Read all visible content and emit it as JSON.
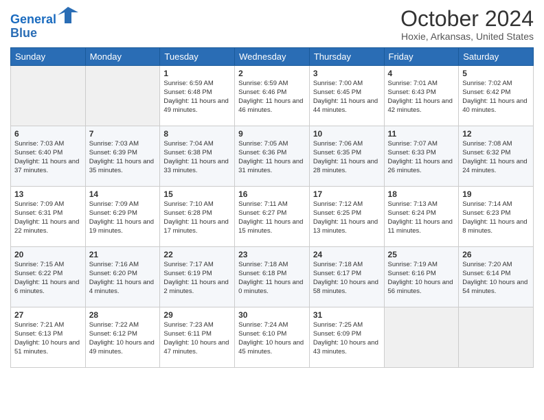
{
  "header": {
    "logo_line1": "General",
    "logo_line2": "Blue",
    "title": "October 2024",
    "subtitle": "Hoxie, Arkansas, United States"
  },
  "weekdays": [
    "Sunday",
    "Monday",
    "Tuesday",
    "Wednesday",
    "Thursday",
    "Friday",
    "Saturday"
  ],
  "weeks": [
    [
      {
        "day": "",
        "info": ""
      },
      {
        "day": "",
        "info": ""
      },
      {
        "day": "1",
        "info": "Sunrise: 6:59 AM\nSunset: 6:48 PM\nDaylight: 11 hours and 49 minutes."
      },
      {
        "day": "2",
        "info": "Sunrise: 6:59 AM\nSunset: 6:46 PM\nDaylight: 11 hours and 46 minutes."
      },
      {
        "day": "3",
        "info": "Sunrise: 7:00 AM\nSunset: 6:45 PM\nDaylight: 11 hours and 44 minutes."
      },
      {
        "day": "4",
        "info": "Sunrise: 7:01 AM\nSunset: 6:43 PM\nDaylight: 11 hours and 42 minutes."
      },
      {
        "day": "5",
        "info": "Sunrise: 7:02 AM\nSunset: 6:42 PM\nDaylight: 11 hours and 40 minutes."
      }
    ],
    [
      {
        "day": "6",
        "info": "Sunrise: 7:03 AM\nSunset: 6:40 PM\nDaylight: 11 hours and 37 minutes."
      },
      {
        "day": "7",
        "info": "Sunrise: 7:03 AM\nSunset: 6:39 PM\nDaylight: 11 hours and 35 minutes."
      },
      {
        "day": "8",
        "info": "Sunrise: 7:04 AM\nSunset: 6:38 PM\nDaylight: 11 hours and 33 minutes."
      },
      {
        "day": "9",
        "info": "Sunrise: 7:05 AM\nSunset: 6:36 PM\nDaylight: 11 hours and 31 minutes."
      },
      {
        "day": "10",
        "info": "Sunrise: 7:06 AM\nSunset: 6:35 PM\nDaylight: 11 hours and 28 minutes."
      },
      {
        "day": "11",
        "info": "Sunrise: 7:07 AM\nSunset: 6:33 PM\nDaylight: 11 hours and 26 minutes."
      },
      {
        "day": "12",
        "info": "Sunrise: 7:08 AM\nSunset: 6:32 PM\nDaylight: 11 hours and 24 minutes."
      }
    ],
    [
      {
        "day": "13",
        "info": "Sunrise: 7:09 AM\nSunset: 6:31 PM\nDaylight: 11 hours and 22 minutes."
      },
      {
        "day": "14",
        "info": "Sunrise: 7:09 AM\nSunset: 6:29 PM\nDaylight: 11 hours and 19 minutes."
      },
      {
        "day": "15",
        "info": "Sunrise: 7:10 AM\nSunset: 6:28 PM\nDaylight: 11 hours and 17 minutes."
      },
      {
        "day": "16",
        "info": "Sunrise: 7:11 AM\nSunset: 6:27 PM\nDaylight: 11 hours and 15 minutes."
      },
      {
        "day": "17",
        "info": "Sunrise: 7:12 AM\nSunset: 6:25 PM\nDaylight: 11 hours and 13 minutes."
      },
      {
        "day": "18",
        "info": "Sunrise: 7:13 AM\nSunset: 6:24 PM\nDaylight: 11 hours and 11 minutes."
      },
      {
        "day": "19",
        "info": "Sunrise: 7:14 AM\nSunset: 6:23 PM\nDaylight: 11 hours and 8 minutes."
      }
    ],
    [
      {
        "day": "20",
        "info": "Sunrise: 7:15 AM\nSunset: 6:22 PM\nDaylight: 11 hours and 6 minutes."
      },
      {
        "day": "21",
        "info": "Sunrise: 7:16 AM\nSunset: 6:20 PM\nDaylight: 11 hours and 4 minutes."
      },
      {
        "day": "22",
        "info": "Sunrise: 7:17 AM\nSunset: 6:19 PM\nDaylight: 11 hours and 2 minutes."
      },
      {
        "day": "23",
        "info": "Sunrise: 7:18 AM\nSunset: 6:18 PM\nDaylight: 11 hours and 0 minutes."
      },
      {
        "day": "24",
        "info": "Sunrise: 7:18 AM\nSunset: 6:17 PM\nDaylight: 10 hours and 58 minutes."
      },
      {
        "day": "25",
        "info": "Sunrise: 7:19 AM\nSunset: 6:16 PM\nDaylight: 10 hours and 56 minutes."
      },
      {
        "day": "26",
        "info": "Sunrise: 7:20 AM\nSunset: 6:14 PM\nDaylight: 10 hours and 54 minutes."
      }
    ],
    [
      {
        "day": "27",
        "info": "Sunrise: 7:21 AM\nSunset: 6:13 PM\nDaylight: 10 hours and 51 minutes."
      },
      {
        "day": "28",
        "info": "Sunrise: 7:22 AM\nSunset: 6:12 PM\nDaylight: 10 hours and 49 minutes."
      },
      {
        "day": "29",
        "info": "Sunrise: 7:23 AM\nSunset: 6:11 PM\nDaylight: 10 hours and 47 minutes."
      },
      {
        "day": "30",
        "info": "Sunrise: 7:24 AM\nSunset: 6:10 PM\nDaylight: 10 hours and 45 minutes."
      },
      {
        "day": "31",
        "info": "Sunrise: 7:25 AM\nSunset: 6:09 PM\nDaylight: 10 hours and 43 minutes."
      },
      {
        "day": "",
        "info": ""
      },
      {
        "day": "",
        "info": ""
      }
    ]
  ]
}
